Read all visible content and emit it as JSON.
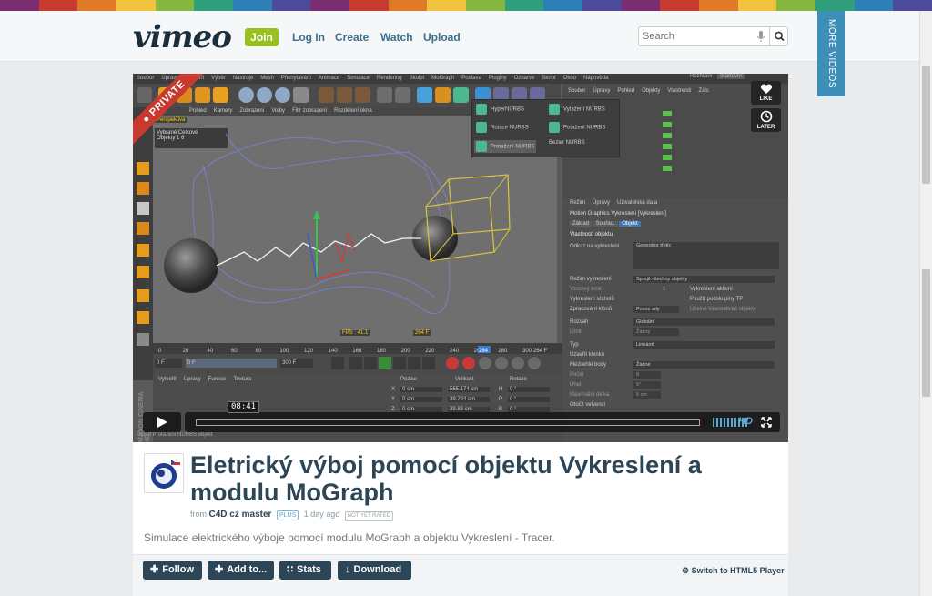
{
  "stripe_colors": [
    "#7a2d73",
    "#c8392f",
    "#e07a26",
    "#f0c33a",
    "#86b83f",
    "#2f9e7a",
    "#2e7fb5",
    "#4c4a9a",
    "#7a2d73",
    "#c8392f",
    "#e07a26",
    "#f0c33a",
    "#86b83f",
    "#2f9e7a",
    "#2e7fb5",
    "#4c4a9a",
    "#7a2d73",
    "#c8392f",
    "#e07a26",
    "#f0c33a",
    "#86b83f",
    "#2f9e7a",
    "#2e7fb5",
    "#4c4a9a"
  ],
  "header": {
    "logo": "vimeo",
    "join": "Join",
    "nav": [
      "Log In",
      "Create",
      "Watch",
      "Upload"
    ],
    "search_placeholder": "Search",
    "more_videos": "MORE VIDEOS"
  },
  "player": {
    "private_label": "PRIVATE",
    "like_label": "LIKE",
    "later_label": "LATER",
    "timecode": "08:41",
    "hd_label": "HD",
    "c4d_menu": [
      "Soubor",
      "Úpravy",
      "Vytvořit",
      "Výběr",
      "Nástroje",
      "Mesh",
      "Přichytávání",
      "Animace",
      "Simulace",
      "Rendering",
      "Skulpt",
      "MoGraph",
      "Postava",
      "Pluginy",
      "Ozbarve",
      "Skript",
      "Okno",
      "Nápověda"
    ],
    "c4d_layout": "Rozhraní",
    "c4d_layout_value": "Startovní",
    "viewport_menu": [
      "Pohled",
      "Kamery",
      "Zobrazení",
      "Volby",
      "Filtr zobrazení",
      "Rozdělení okna"
    ],
    "perspective": "Perspektiva",
    "hud_header": "Vybrané  Celkové",
    "hud_row": "Objekty  1      6",
    "fps": "FPS : 41.1",
    "frame": "264 F",
    "nurbs_items": [
      "HyperNURBS",
      "Vytažení NURBS",
      "Rotace NURBS",
      "Potažení NURBS",
      "Protažení NURBS",
      "Bezier NURBS"
    ],
    "obj_tabs": [
      "Soubor",
      "Úpravy",
      "Pohled",
      "Objekty",
      "Vlastnosti",
      "Záls"
    ],
    "attr_tabs": [
      "Režim",
      "Úpravy",
      "Uživatelská data"
    ],
    "attr_title": "Motion Graphics Vykreslení [Vykreslení]",
    "attr_subtabs": [
      "Základ",
      "Souřad.",
      "Objekt"
    ],
    "attr_section": "Vlastnosti objektu",
    "attr_rows": [
      [
        "Odkaz na vykreslení",
        "Generátor třetic"
      ],
      [
        "Režim vykreslení",
        "Sprejit všechny objekty"
      ],
      [
        "Vzorový krok",
        "1"
      ],
      [
        "Vykreslení sřcholů",
        ""
      ],
      [
        "Zpracování klonů",
        "Povoz ady"
      ],
      [
        "Rozsah",
        "Globální"
      ],
      [
        "Limit",
        "Žádný"
      ],
      [
        "Typ",
        "Lineární"
      ],
      [
        "Uzavřít klenku",
        ""
      ],
      [
        "Mezilehlé body",
        "Žádné"
      ],
      [
        "Počet",
        "8"
      ],
      [
        "Úhel",
        "5°"
      ],
      [
        "Maximální délka",
        "5 cm"
      ],
      [
        "Otočit velvenci",
        ""
      ]
    ],
    "attr_right": [
      "Vykreslení aktivní",
      "Použít podskupiny TP",
      "Účelné kinematické objekty"
    ],
    "timeline_ticks": [
      "0",
      "20",
      "40",
      "60",
      "80",
      "100",
      "120",
      "140",
      "160",
      "180",
      "200",
      "220",
      "240",
      "260",
      "280",
      "300"
    ],
    "timeline_current": "264",
    "timeline_end": "264 F",
    "frame_start": "0 F",
    "frame_mid": "0 F",
    "frame_end": "300 F",
    "bottom_menu": [
      "Vytvořit",
      "Úpravy",
      "Funkce",
      "Textura"
    ],
    "coord_headers": [
      "Pozice",
      "Velikost",
      "Rotace"
    ],
    "coord_rows": [
      [
        "X",
        "0 cm",
        "565.174 cm",
        "H",
        "0 °"
      ],
      [
        "Y",
        "0 cm",
        "39.784 cm",
        "P",
        "0 °"
      ],
      [
        "Z",
        "0 cm",
        "39.83 cm",
        "B",
        "0 °"
      ]
    ],
    "status": "Proud Protažení NURBS objekt",
    "maxon": "MAXON CINEMA 4D"
  },
  "video": {
    "title": "Eletrický výboj pomocí objektu Vykreslení a modulu MoGraph",
    "from": "from",
    "author": "C4D cz master",
    "plus": "PLUS",
    "age": "1 day ago",
    "rating": "NOT YET RATED",
    "description": "Simulace elektrického výboje pomocí modulu MoGraph a objektu Vykreslení - Tracer."
  },
  "actions": {
    "follow": "Follow",
    "add_to": "Add to...",
    "stats": "Stats",
    "download": "Download",
    "html5": "Switch to HTML5 Player"
  },
  "colors": {
    "brand_green": "#96c11f",
    "brand_dark": "#2c4657",
    "brand_blue": "#3d8fb8",
    "private_red": "#c8392f"
  }
}
